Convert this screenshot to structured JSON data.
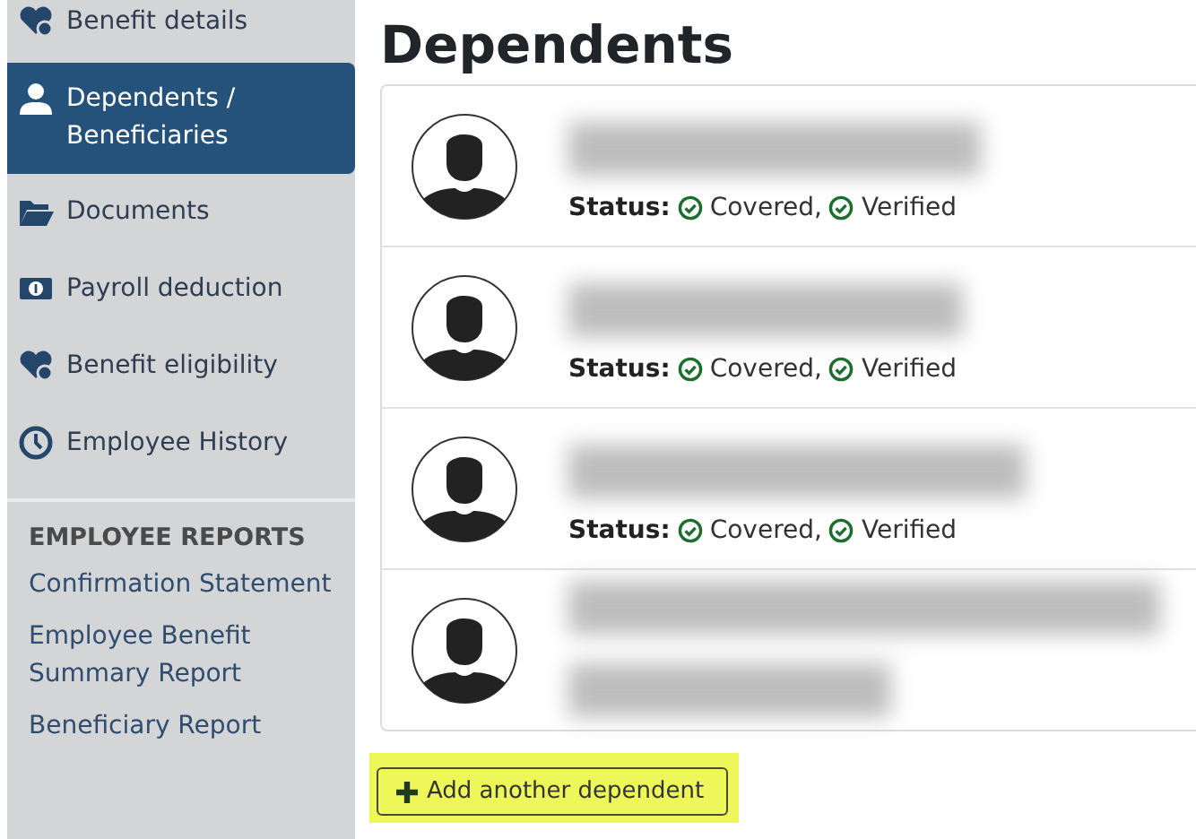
{
  "sidebar": {
    "items": [
      {
        "label": "Benefit details",
        "selected": false
      },
      {
        "label": "Dependents / Beneficiaries",
        "selected": true
      },
      {
        "label": "Documents",
        "selected": false
      },
      {
        "label": "Payroll deduction",
        "selected": false
      },
      {
        "label": "Benefit eligibility",
        "selected": false
      },
      {
        "label": "Employee History",
        "selected": false
      }
    ],
    "reports": {
      "heading": "EMPLOYEE REPORTS",
      "links": [
        "Confirmation Statement",
        "Employee Benefit Summary Report",
        "Beneficiary Report"
      ]
    }
  },
  "main": {
    "heading": "Dependents",
    "dependents": [
      {
        "status_label": "Status:",
        "statuses": [
          {
            "text": "Covered,"
          },
          {
            "text": "Verified"
          }
        ]
      },
      {
        "status_label": "Status:",
        "statuses": [
          {
            "text": "Covered,"
          },
          {
            "text": "Verified"
          }
        ]
      },
      {
        "status_label": "Status:",
        "statuses": [
          {
            "text": "Covered,"
          },
          {
            "text": "Verified"
          }
        ]
      },
      {
        "kind": "redacted"
      }
    ],
    "add_button": {
      "label": "Add another dependent",
      "highlighted": true
    }
  }
}
